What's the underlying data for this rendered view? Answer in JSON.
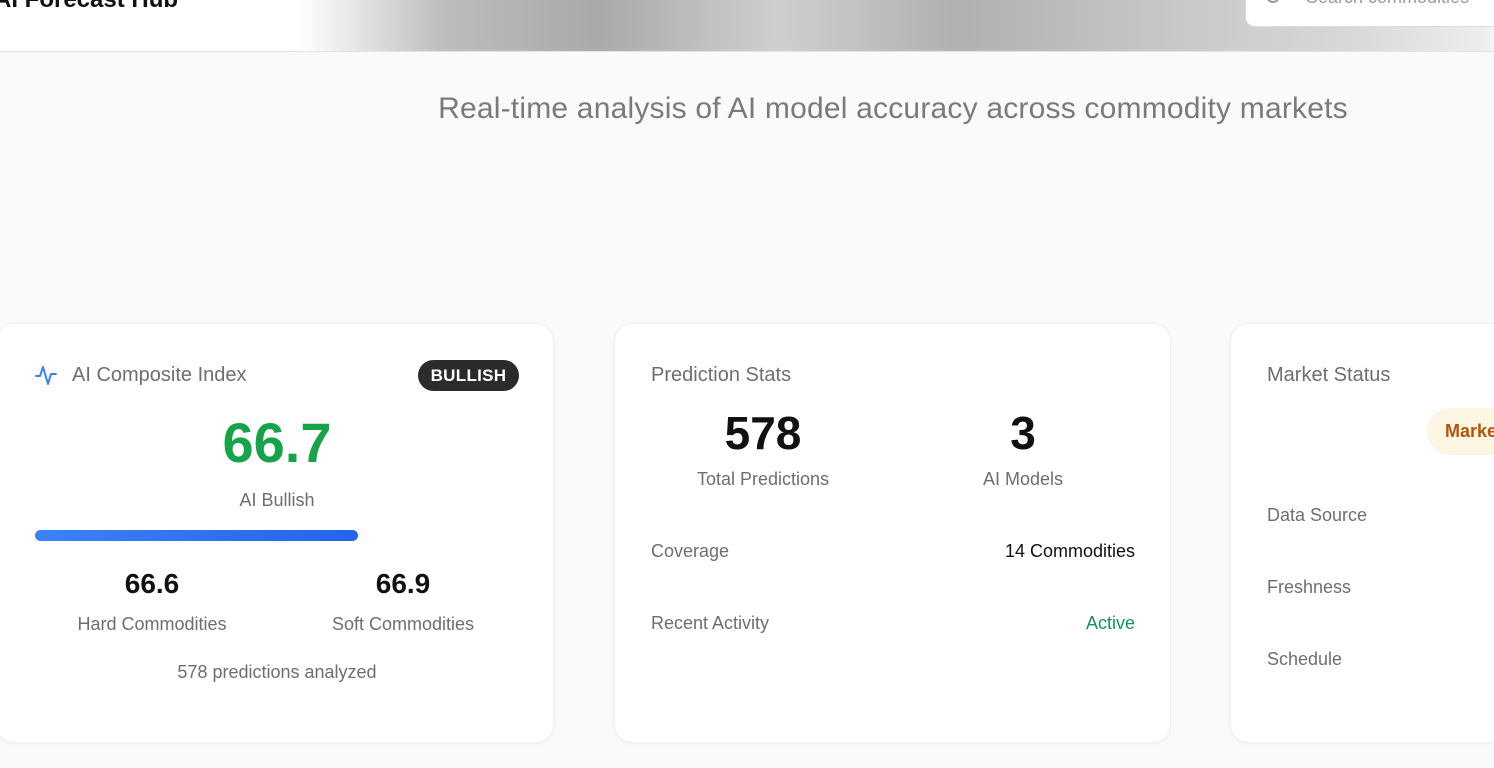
{
  "header": {
    "brand": "AI Forecast Hub",
    "search_placeholder": "Search commodities"
  },
  "subtitle": "Real-time analysis of AI model accuracy across commodity markets",
  "composite": {
    "title": "AI Composite Index",
    "badge": "BULLISH",
    "score": "66.7",
    "score_label": "AI Bullish",
    "progress_percent": 66.7,
    "hard_value": "66.6",
    "hard_label": "Hard Commodities",
    "soft_value": "66.9",
    "soft_label": "Soft Commodities",
    "footnote": "578 predictions analyzed",
    "colors": {
      "score": "#16a34a",
      "bar": "#2563eb",
      "badge": "#2b2b2b"
    },
    "icon": "activity-pulse-icon"
  },
  "prediction_stats": {
    "title": "Prediction Stats",
    "total_predictions": "578",
    "total_predictions_label": "Total Predictions",
    "ai_models": "3",
    "ai_models_label": "AI Models",
    "coverage_label": "Coverage",
    "coverage_value": "14 Commodities",
    "recent_activity_label": "Recent Activity",
    "recent_activity_value": "Active",
    "colors": {
      "active": "#15935b"
    }
  },
  "market_status": {
    "title": "Market Status",
    "status_pill": "Marke",
    "data_source_label": "Data Source",
    "freshness_label": "Freshness",
    "schedule_label": "Schedule",
    "colors": {
      "pill_bg": "#fdf6e3",
      "pill_text": "#b4530a"
    }
  }
}
